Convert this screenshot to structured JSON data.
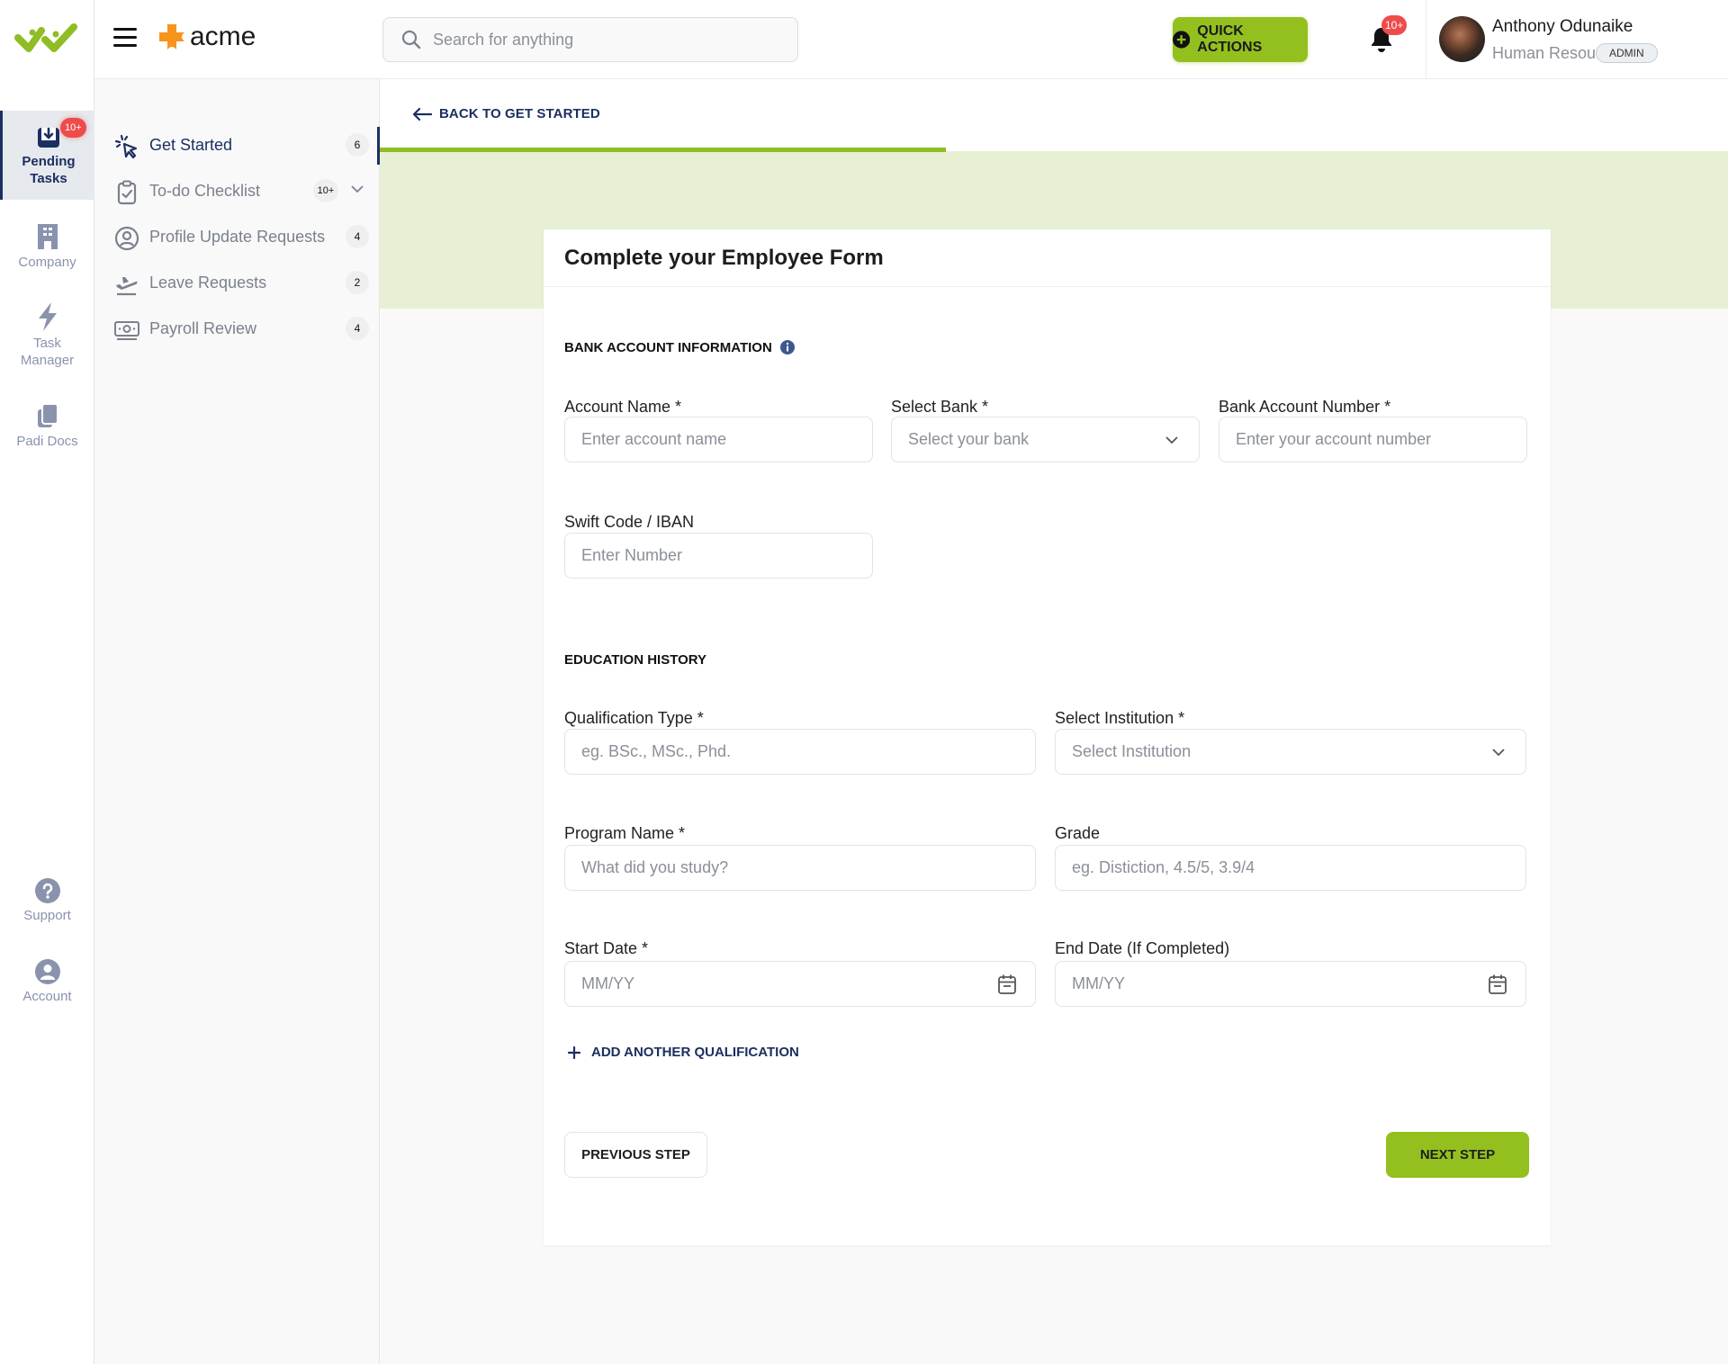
{
  "brand": {
    "app_logo": "double-check-logo",
    "company_logo": "orange-plus-logo",
    "company_name": "acme"
  },
  "colors": {
    "accent_green": "#93c01f",
    "navy": "#1c2f61",
    "badge_red": "#ef4b4b",
    "band_green": "#e7f0d4"
  },
  "rail": {
    "items": [
      {
        "label": "Pending Tasks",
        "icon": "inbox-download-icon",
        "badge": "10+",
        "active": true
      },
      {
        "label": "Company",
        "icon": "building-icon"
      },
      {
        "label": "Task Manager",
        "icon": "lightning-icon"
      },
      {
        "label": "Padi Docs",
        "icon": "documents-icon"
      }
    ],
    "bottom_items": [
      {
        "label": "Support",
        "icon": "question-circle-icon"
      },
      {
        "label": "Account",
        "icon": "user-circle-icon"
      }
    ]
  },
  "header": {
    "search_placeholder": "Search for anything",
    "quick_actions_label": "QUICK ACTIONS",
    "notification_badge": "10+",
    "user": {
      "name": "Anthony Odunaike",
      "role": "Human Resou...",
      "badge": "ADMIN"
    }
  },
  "panel": {
    "items": [
      {
        "label": "Get Started",
        "count": "6",
        "active": true
      },
      {
        "label": "To-do Checklist",
        "count": "10+",
        "expandable": true
      },
      {
        "label": "Profile Update Requests",
        "count": "4"
      },
      {
        "label": "Leave Requests",
        "count": "2"
      },
      {
        "label": "Payroll Review",
        "count": "4"
      }
    ]
  },
  "main": {
    "back_label": "BACK TO GET STARTED",
    "progress_percent": 42,
    "form": {
      "title": "Complete your Employee Form",
      "bank_section": {
        "title": "BANK ACCOUNT INFORMATION",
        "fields": [
          {
            "label": "Account Name *",
            "placeholder": "Enter account name",
            "type": "text",
            "value": ""
          },
          {
            "label": "Select Bank *",
            "placeholder": "Select your bank",
            "type": "select",
            "value": ""
          },
          {
            "label": "Bank Account Number *",
            "placeholder": "Enter your account number",
            "type": "text",
            "value": ""
          },
          {
            "label": "Swift Code / IBAN",
            "placeholder": "Enter Number",
            "type": "text",
            "value": ""
          }
        ]
      },
      "education_section": {
        "title": "EDUCATION HISTORY",
        "fields": [
          {
            "label": "Qualification Type *",
            "placeholder": "eg. BSc., MSc., Phd.",
            "type": "text",
            "value": ""
          },
          {
            "label": "Select Institution *",
            "placeholder": "Select Institution",
            "type": "select",
            "value": ""
          },
          {
            "label": "Program Name *",
            "placeholder": "What did you study?",
            "type": "text",
            "value": ""
          },
          {
            "label": "Grade",
            "placeholder": "eg. Distiction, 4.5/5, 3.9/4",
            "type": "text",
            "value": ""
          },
          {
            "label": "Start Date *",
            "placeholder": "MM/YY",
            "type": "date",
            "value": ""
          },
          {
            "label": "End Date (If Completed)",
            "placeholder": "MM/YY",
            "type": "date",
            "value": ""
          }
        ],
        "add_label": "ADD ANOTHER QUALIFICATION"
      },
      "prev_label": "PREVIOUS STEP",
      "next_label": "NEXT STEP"
    }
  }
}
